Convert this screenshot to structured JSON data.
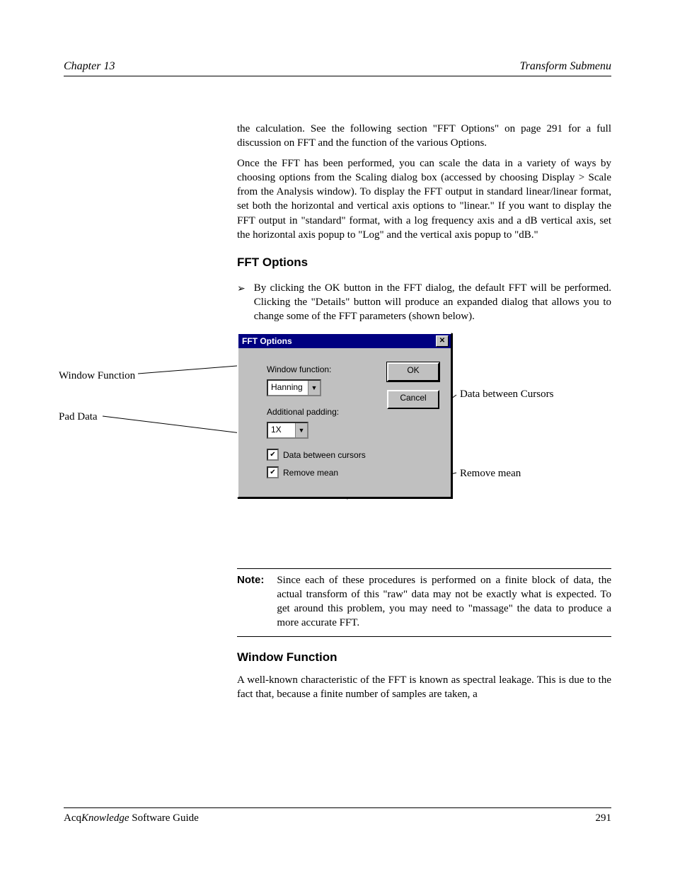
{
  "header": {
    "left": "Chapter 13",
    "right": "Transform Submenu"
  },
  "body": {
    "p1": "the calculation. See the following section \"FFT Options\" on page 291 for a full discussion on FFT and the function of the various Options.",
    "p2": "Once the FFT has been performed, you can scale the data in a variety of ways by choosing options from the Scaling dialog box (accessed by choosing Display > Scale from the Analysis window). To display the FFT output in standard linear/linear format, set both the horizontal and vertical axis options to \"linear.\" If you want to display the FFT output in \"standard\" format, with a log frequency axis and a dB vertical axis, set the horizontal axis popup to \"Log\" and the vertical axis popup to \"dB.\""
  },
  "fftOptionsHeading": "FFT Options",
  "arrow": {
    "text": "By clicking the OK button in the FFT dialog, the default FFT will be performed. Clicking the \"Details\" button will produce an expanded dialog that allows you to change some of the FFT parameters (shown below)."
  },
  "dialog": {
    "title": "FFT Options",
    "windowFunctionLabel": "Window function:",
    "windowFunctionValue": "Hanning",
    "additionalPaddingLabel": "Additional padding:",
    "additionalPaddingValue": "1X",
    "dataBetweenCursorsLabel": "Data between cursors",
    "removeMeanLabel": "Remove mean",
    "okLabel": "OK",
    "cancelLabel": "Cancel"
  },
  "callouts": {
    "windowFunction": "Window Function",
    "padData": "Pad Data",
    "dataBetweenCursors": "Data between Cursors",
    "removeMean": "Remove mean"
  },
  "note": {
    "hdr": "Note:",
    "body": "Since each of these procedures is performed on a finite block of data, the actual transform of this \"raw\" data may not be exactly what is expected. To get around this problem, you may need to \"massage\" the data to produce a more accurate FFT."
  },
  "afterNote": {
    "windowHeading": "Window Function",
    "windowBody": "A well-known characteristic of the FFT is known as spectral leakage. This is due to the fact that, because a finite number of samples are taken, a"
  },
  "footer": {
    "left": "Acq",
    "leftItalic": "Knowledge",
    "leftRest": " Software Guide",
    "right": "291"
  }
}
